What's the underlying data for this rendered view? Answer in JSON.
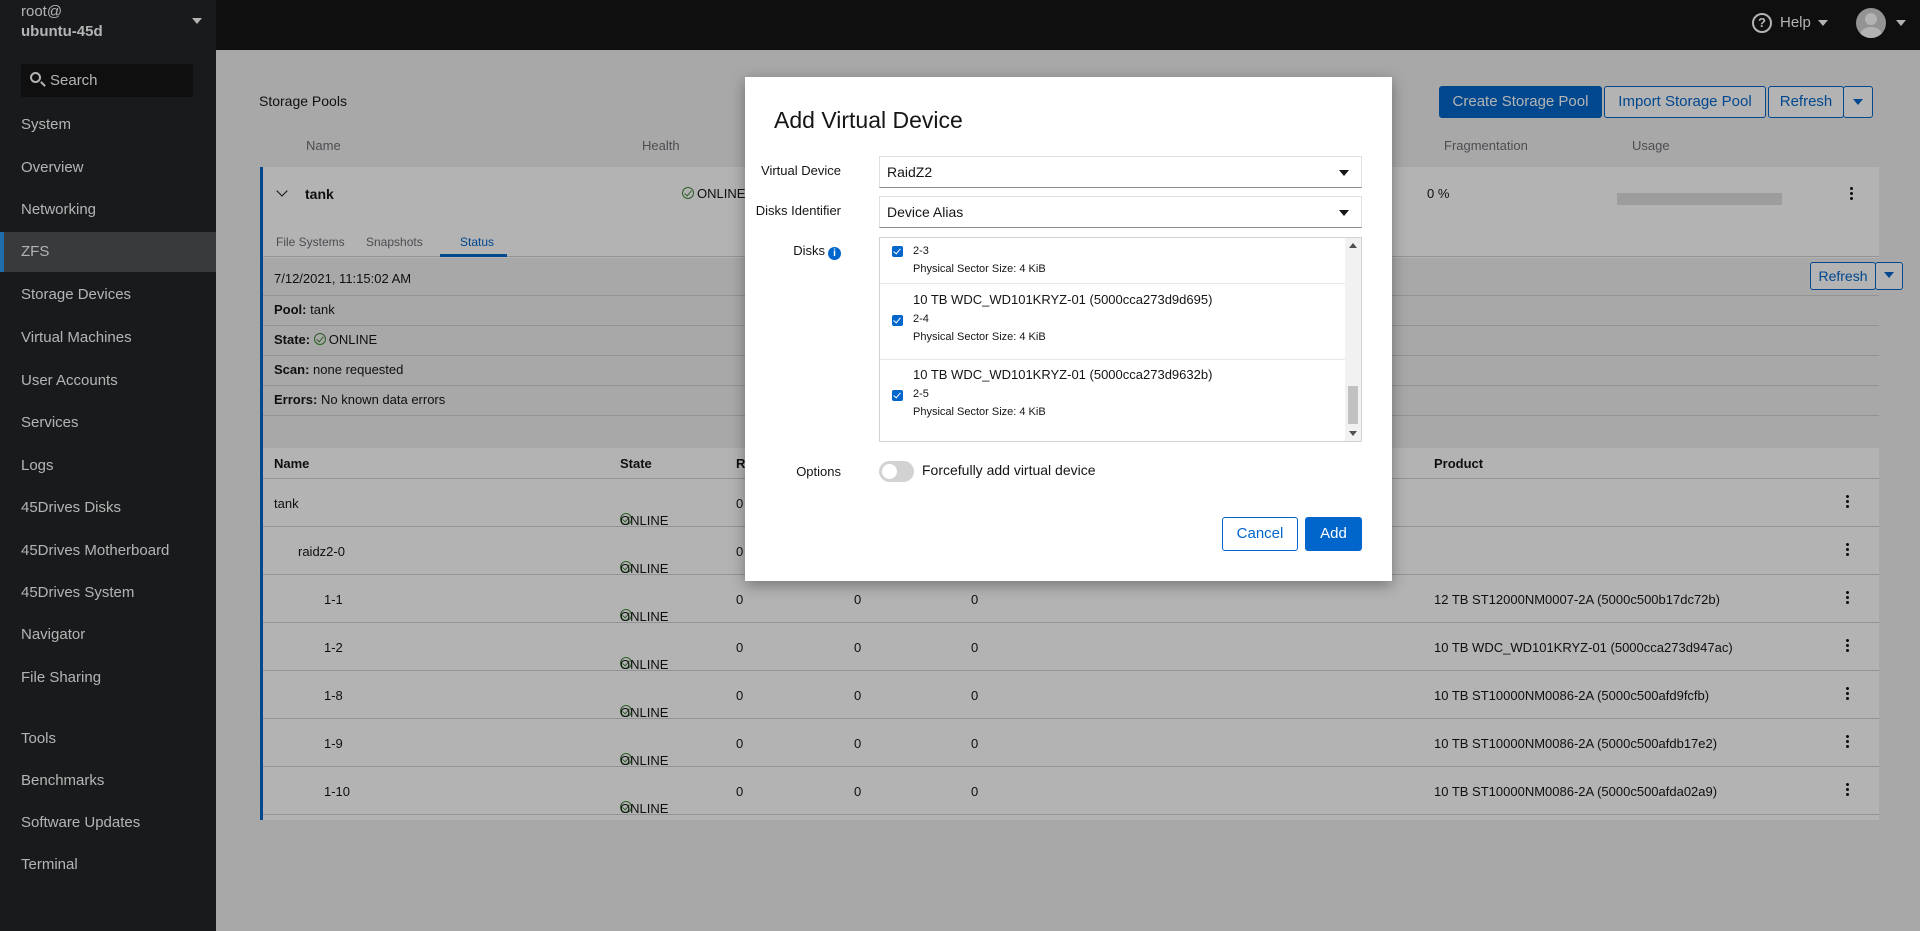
{
  "host": {
    "line1": "root@",
    "line2": "ubuntu-45d"
  },
  "search": {
    "placeholder": "Search"
  },
  "sidebar": {
    "items": [
      {
        "label": "System"
      },
      {
        "label": "Overview"
      },
      {
        "label": "Networking"
      },
      {
        "label": "ZFS"
      },
      {
        "label": "Storage Devices"
      },
      {
        "label": "Virtual Machines"
      },
      {
        "label": "User Accounts"
      },
      {
        "label": "Services"
      },
      {
        "label": "Logs"
      },
      {
        "label": "45Drives Disks"
      },
      {
        "label": "45Drives Motherboard"
      },
      {
        "label": "45Drives System"
      },
      {
        "label": "Navigator"
      },
      {
        "label": "File Sharing"
      },
      {
        "label": "Tools"
      },
      {
        "label": "Benchmarks"
      },
      {
        "label": "Software Updates"
      },
      {
        "label": "Terminal"
      }
    ]
  },
  "topbar": {
    "help_label": "Help",
    "help_glyph": "?"
  },
  "main": {
    "title": "Storage Pools",
    "buttons": {
      "create": "Create Storage Pool",
      "import": "Import Storage Pool",
      "refresh": "Refresh"
    },
    "pool_headers": {
      "name": "Name",
      "health": "Health",
      "fragmentation": "Fragmentation",
      "usage": "Usage"
    },
    "pool": {
      "name": "tank",
      "health": "ONLINE",
      "fragmentation": "0 %"
    },
    "tabs": {
      "file_systems": "File Systems",
      "snapshots": "Snapshots",
      "status": "Status"
    },
    "status": {
      "timestamp": "7/12/2021, 11:15:02 AM",
      "refresh": "Refresh",
      "pool_label": "Pool:",
      "pool_value": "tank",
      "state_label": "State:",
      "state_value": "ONLINE",
      "scan_label": "Scan:",
      "scan_value": "none requested",
      "errors_label": "Errors:",
      "errors_value": "No known data errors"
    },
    "device_headers": {
      "name": "Name",
      "state": "State",
      "read_partial": "R",
      "product": "Product"
    },
    "devices": [
      {
        "name": "tank",
        "state": "ONLINE",
        "c1": "0",
        "c2": "",
        "c3": "",
        "product": ""
      },
      {
        "name": "raidz2-0",
        "state": "ONLINE",
        "c1": "0",
        "c2": "",
        "c3": "",
        "product": ""
      },
      {
        "name": "1-1",
        "state": "ONLINE",
        "c1": "0",
        "c2": "0",
        "c3": "0",
        "product": "12 TB ST12000NM0007-2A (5000c500b17dc72b)"
      },
      {
        "name": "1-2",
        "state": "ONLINE",
        "c1": "0",
        "c2": "0",
        "c3": "0",
        "product": "10 TB WDC_WD101KRYZ-01 (5000cca273d947ac)"
      },
      {
        "name": "1-8",
        "state": "ONLINE",
        "c1": "0",
        "c2": "0",
        "c3": "0",
        "product": "10 TB ST10000NM0086-2A (5000c500afd9fcfb)"
      },
      {
        "name": "1-9",
        "state": "ONLINE",
        "c1": "0",
        "c2": "0",
        "c3": "0",
        "product": "10 TB ST10000NM0086-2A (5000c500afdb17e2)"
      },
      {
        "name": "1-10",
        "state": "ONLINE",
        "c1": "0",
        "c2": "0",
        "c3": "0",
        "product": "10 TB ST10000NM0086-2A (5000c500afda02a9)"
      }
    ]
  },
  "modal": {
    "title": "Add Virtual Device",
    "virtual_device_label": "Virtual Device",
    "virtual_device_value": "RaidZ2",
    "disks_identifier_label": "Disks Identifier",
    "disks_identifier_value": "Device Alias",
    "disks_label": "Disks",
    "info_glyph": "i",
    "disks": [
      {
        "name": "",
        "alias": "2-3",
        "sector": "Physical Sector Size: 4 KiB",
        "checked": true
      },
      {
        "name": "10 TB WDC_WD101KRYZ-01 (5000cca273d9d695)",
        "alias": "2-4",
        "sector": "Physical Sector Size: 4 KiB",
        "checked": true
      },
      {
        "name": "10 TB WDC_WD101KRYZ-01 (5000cca273d9632b)",
        "alias": "2-5",
        "sector": "Physical Sector Size: 4 KiB",
        "checked": true
      }
    ],
    "options_label": "Options",
    "force_label": "Forcefully add virtual device",
    "force_on": false,
    "cancel": "Cancel",
    "add": "Add"
  },
  "colors": {
    "accent": "#0066cc",
    "online": "#3e8635",
    "sidebar_bg": "#212427",
    "topbar_bg": "#151515"
  }
}
